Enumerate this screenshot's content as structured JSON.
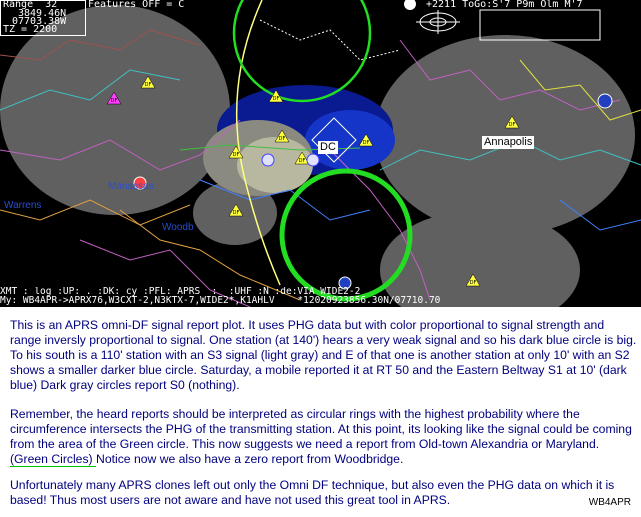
{
  "hud": {
    "range_line": "Range  32",
    "lat": "3849.46N",
    "lon": "07703.38W",
    "tz": "TZ = 2200",
    "features": "Features OFF = C",
    "top_right": "+2211 ToGo:S'7 P9m Olm M'7"
  },
  "map_labels": {
    "dc": "DC",
    "annapolis": "Annapolis",
    "town_left": "Warrens",
    "town_mid": "Manassas",
    "town_low": "Woodb"
  },
  "status": {
    "line1": "XMT : log :UP: . :DK: cy :PFL: APRS  :  :UHF :N :de:VIA WIDE2-2",
    "line2": "My: WB4APR->APRX76,W3CXT-2,N3KTX-7,WIDE2*,K1AHLV    *12020923856.30N/07710.70"
  },
  "description": {
    "p1_a": "This is an APRS omni-DF signal report plot.  It uses PHG data but with color proportional to signal strength and range inversly proportional to signal.  One station (at 140') hears a very weak signal and so his dark blue circle is big.  To his  south is a 110' station with an S3 signal (light gray) and E of that one is another station at only 10' with an S2 shows a smaller darker blue circle.  Saturday, a mobile reported it at RT 50 and the Eastern Beltway S1 at 10' (dark blue)   Dark gray circles report S0 (nothing).",
    "p2_a": "Remember, the heard reports should be interpreted as circular rings with the highest probability where the circumference intersects the PHG of the transmitting station.  At this point, its looking like the signal could be coming from the area of the Green circle.  This now suggests we need a report from Old-town Alexandria or Maryland. ",
    "p2_green": " (Green Circles)  ",
    "p2_b": "   Notice now we also have a zero report from Woodbridge.",
    "p3": "Unfortunately many APRS clones left out only the Omni DF technique, but also even the PHG data on which it is based!  Thus most users are not aware and have not used this great tool in APRS.",
    "credit": "WB4APR"
  },
  "colors": {
    "map_bg": "#000000",
    "dark_gray": "#606060",
    "light_gray": "#b8b8a0",
    "dark_blue": "#0a1a90",
    "blue": "#1535c8",
    "green": "#22dd22",
    "yellow_track": "#ffff80",
    "text_navy": "#000080"
  },
  "icons": [
    "df-triangle-icon",
    "station-icon",
    "bullseye-icon"
  ]
}
